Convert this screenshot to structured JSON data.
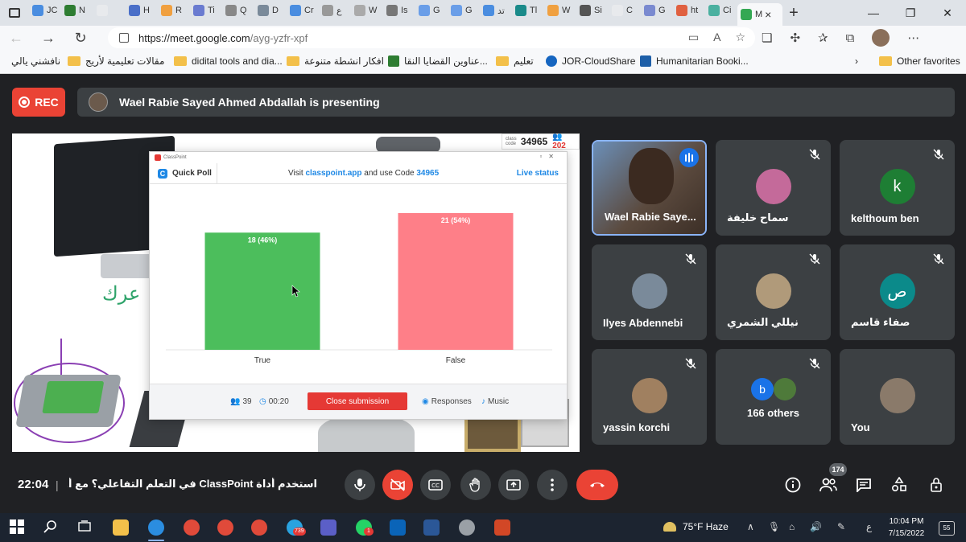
{
  "browser": {
    "tabs": [
      {
        "label": "JC",
        "color": "#4a8de0"
      },
      {
        "label": "N",
        "color": "#2e7d32"
      },
      {
        "label": "",
        "color": "#e8eaed"
      },
      {
        "label": "H",
        "color": "#4a6fc8"
      },
      {
        "label": "R",
        "color": "#f0a040"
      },
      {
        "label": "Ti",
        "color": "#6a7bd0"
      },
      {
        "label": "Q",
        "color": "#888888"
      },
      {
        "label": "D",
        "color": "#7a8a9a"
      },
      {
        "label": "Cr",
        "color": "#4a8de0"
      },
      {
        "label": "ع",
        "color": "#999999"
      },
      {
        "label": "W",
        "color": "#aaaaaa"
      },
      {
        "label": "Is",
        "color": "#777777"
      },
      {
        "label": "G",
        "color": "#6a9ee8"
      },
      {
        "label": "G",
        "color": "#6a9ee8"
      },
      {
        "label": "تد",
        "color": "#4a8de0"
      },
      {
        "label": "Tl",
        "color": "#1a8a8a"
      },
      {
        "label": "W",
        "color": "#f0a040"
      },
      {
        "label": "Si",
        "color": "#555555"
      },
      {
        "label": "C",
        "color": "#e8eaed"
      },
      {
        "label": "G",
        "color": "#7a8ad0"
      },
      {
        "label": "ht",
        "color": "#e06040"
      },
      {
        "label": "Ci",
        "color": "#4ab0a0"
      },
      {
        "label": "M",
        "color": "#34a853"
      }
    ],
    "new_tab": "+",
    "window_controls": {
      "minimize": "—",
      "maximize": "❐",
      "close": "✕"
    },
    "url_host": "https://meet.google.com",
    "url_path": "/ayg-yzfr-xpf",
    "bookmarks": [
      {
        "label": "نافشني يالي",
        "kind": "folder"
      },
      {
        "label": "مقالات تعليمية لأريج",
        "kind": "folder"
      },
      {
        "label": "didital tools and dia...",
        "kind": "folder"
      },
      {
        "label": "افكار انشطة متنوعة",
        "kind": "folder"
      },
      {
        "label": "عناوين القضايا النقا...",
        "kind": "app"
      },
      {
        "label": "تعليم",
        "kind": "folder"
      },
      {
        "label": "JOR-CloudShare",
        "kind": "app"
      },
      {
        "label": "Humanitarian Booki...",
        "kind": "app"
      },
      {
        "label": "Other favorites",
        "kind": "folder"
      }
    ]
  },
  "meet": {
    "rec_label": "REC",
    "presenting_text": "Wael Rabie Sayed Ahmed Abdallah is presenting",
    "time": "22:04",
    "separator": "|",
    "meeting_title": "استخدم أداة ClassPoint في التعلم التفاعلي؟ مع أ. وائل ربيع...",
    "people_count": "174",
    "slide_handwriting": "عرك"
  },
  "classpoint": {
    "window_title": "ClassPoint",
    "brand": "Quick Poll",
    "visit_prefix": "Visit",
    "site": "classpoint.app",
    "visit_mid": "and use Code",
    "code": "34965",
    "live_status": "Live status",
    "class_code_label": "class code",
    "class_code": "34965",
    "participants_badge": "202",
    "footer": {
      "participants": "39",
      "timer": "00:20",
      "close_submission": "Close submission",
      "responses": "Responses",
      "music": "Music"
    }
  },
  "chart_data": {
    "type": "bar",
    "categories": [
      "True",
      "False"
    ],
    "values": [
      18,
      21
    ],
    "value_labels": [
      "18 (46%)",
      "21 (54%)"
    ],
    "colors": [
      "#4cbe5c",
      "#fe7f88"
    ],
    "ylim": [
      0,
      21
    ],
    "title": "",
    "xlabel": "",
    "ylabel": ""
  },
  "participants": [
    {
      "name": "Wael Rabie Saye...",
      "type": "video",
      "speaking": true
    },
    {
      "name": "سماح خليفة",
      "type": "photo",
      "color": "#c46a9a"
    },
    {
      "name": "kelthoum ben",
      "type": "letter",
      "letter": "k",
      "color": "#1e7e34"
    },
    {
      "name": "Ilyes Abdennebi",
      "type": "photo",
      "color": "#7a8a9a"
    },
    {
      "name": "نيللي الشمري",
      "type": "photo",
      "color": "#b09a7a"
    },
    {
      "name": "صفاء قاسم",
      "type": "letter",
      "letter": "ص",
      "color": "#0b8a8a"
    },
    {
      "name": "yassin korchi",
      "type": "photo",
      "color": "#a08060"
    },
    {
      "name": "166 others",
      "type": "others",
      "letter": "b"
    },
    {
      "name": "You",
      "type": "photo",
      "color": "#8a7a6a"
    }
  ],
  "taskbar": {
    "weather": "75°F  Haze",
    "time": "10:04 PM",
    "date": "7/15/2022",
    "lang": "ع",
    "notifications": "55",
    "badge_telegram": "739",
    "badge_whatsapp": "1"
  }
}
